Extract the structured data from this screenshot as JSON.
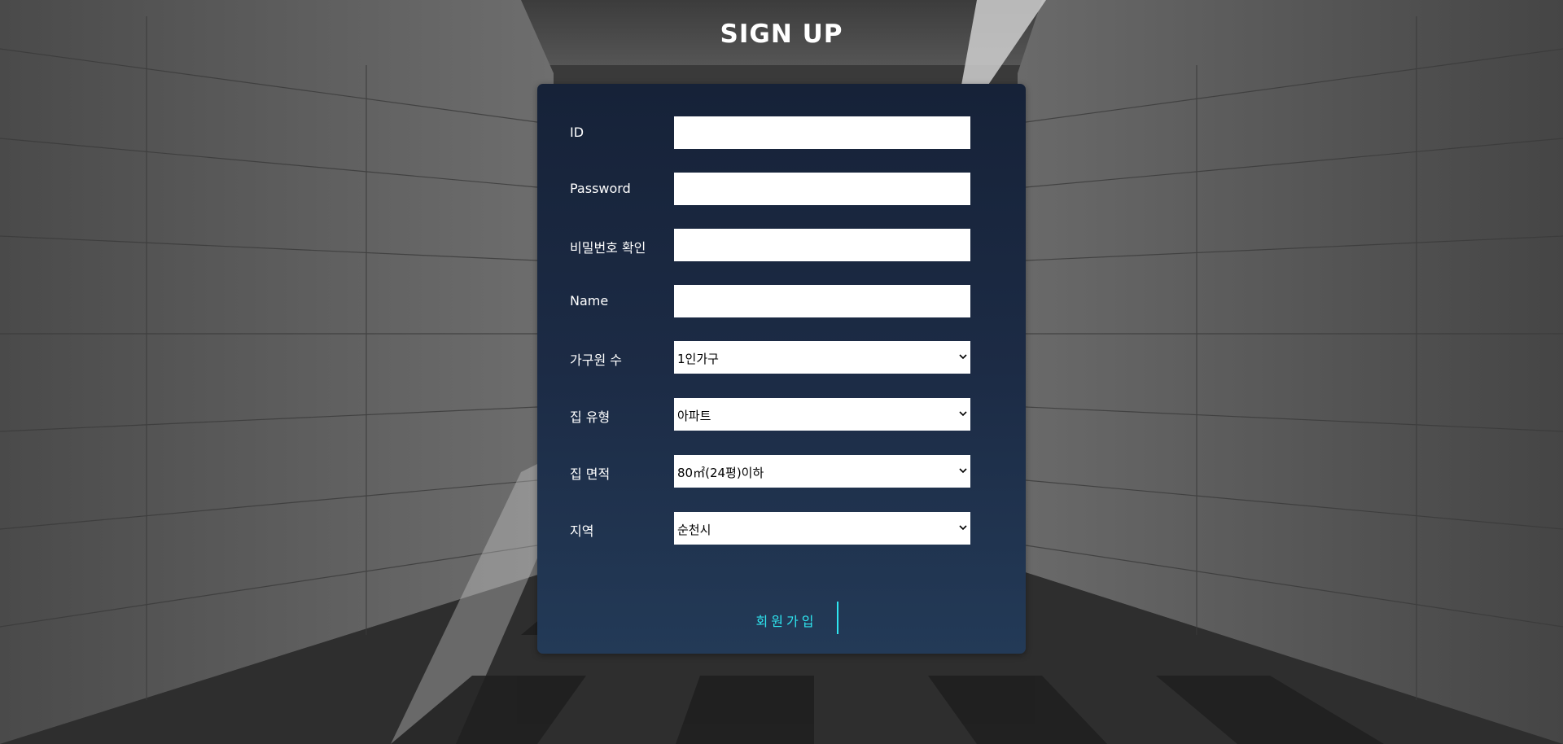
{
  "page": {
    "title": "SIGN UP"
  },
  "form": {
    "id": {
      "label": "ID",
      "value": ""
    },
    "password": {
      "label": "Password",
      "value": ""
    },
    "password_confirm": {
      "label": "비밀번호 확인",
      "value": ""
    },
    "name": {
      "label": "Name",
      "value": ""
    },
    "household": {
      "label": "가구원 수",
      "selected": "1인가구"
    },
    "house_type": {
      "label": "집 유형",
      "selected": "아파트"
    },
    "house_area": {
      "label": "집 면적",
      "selected": "80㎡(24평)이하"
    },
    "region": {
      "label": "지역",
      "selected": "순천시"
    },
    "submit_label": "회원가입"
  },
  "colors": {
    "panel_top": "#162238",
    "panel_bottom": "#233a57",
    "accent": "#2ee6f0"
  },
  "icons": {
    "select_chevron": "chevron-down-icon"
  }
}
